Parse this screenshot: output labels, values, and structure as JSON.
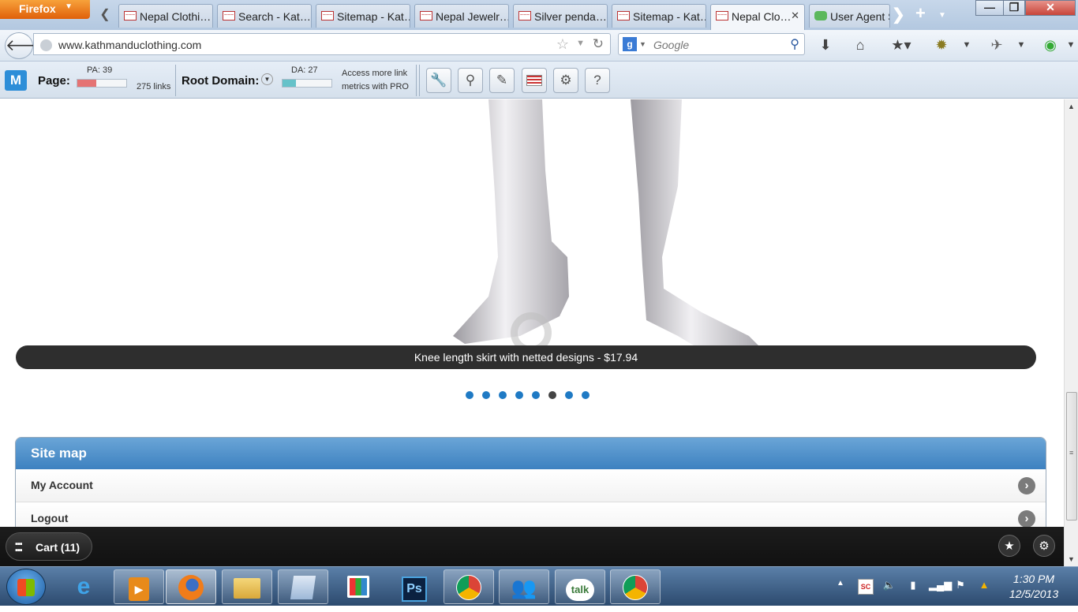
{
  "browser": {
    "menu_button": "Firefox",
    "tabs": [
      {
        "label": "Nepal Clothi…",
        "favicon": "kathmandu-favicon"
      },
      {
        "label": "Search - Kat…",
        "favicon": "kathmandu-favicon"
      },
      {
        "label": "Sitemap - Kat…",
        "favicon": "kathmandu-favicon"
      },
      {
        "label": "Nepal Jewelr…",
        "favicon": "kathmandu-favicon"
      },
      {
        "label": "Silver penda…",
        "favicon": "kathmandu-favicon"
      },
      {
        "label": "Sitemap - Kat…",
        "favicon": "kathmandu-favicon"
      },
      {
        "label": "Nepal Clo…",
        "favicon": "kathmandu-favicon",
        "active": true
      },
      {
        "label": "User Agent S",
        "favicon": "puzzle-favicon"
      }
    ],
    "url": "www.kathmanduclothing.com",
    "search_placeholder": "Google"
  },
  "mozbar": {
    "page_label": "Page:",
    "pa_label": "PA: 39",
    "pa_value": 39,
    "links_label": "275 links",
    "root_domain_label": "Root Domain:",
    "da_label": "DA: 27",
    "da_value": 27,
    "pro_line1": "Access more link",
    "pro_line2": "metrics with PRO",
    "pa_color": "#e57373",
    "da_color": "#66c2c9"
  },
  "page": {
    "slide_caption": "Knee length skirt with netted designs - $17.94",
    "slide_count": 8,
    "active_slide": 5,
    "sitemap": {
      "title": "Site map",
      "items": [
        "My Account",
        "Logout"
      ]
    },
    "cart_label": "Cart (11)",
    "accent_color": "#1f7ac4"
  },
  "taskbar": {
    "apps": [
      "internet-explorer",
      "media-player",
      "firefox",
      "file-explorer",
      "notepad",
      "app-grid",
      "photoshop",
      "chrome",
      "messenger",
      "google-talk",
      "chrome-profile"
    ],
    "talk_label": "talk",
    "ps_label": "Ps",
    "time": "1:30 PM",
    "date": "12/5/2013"
  }
}
